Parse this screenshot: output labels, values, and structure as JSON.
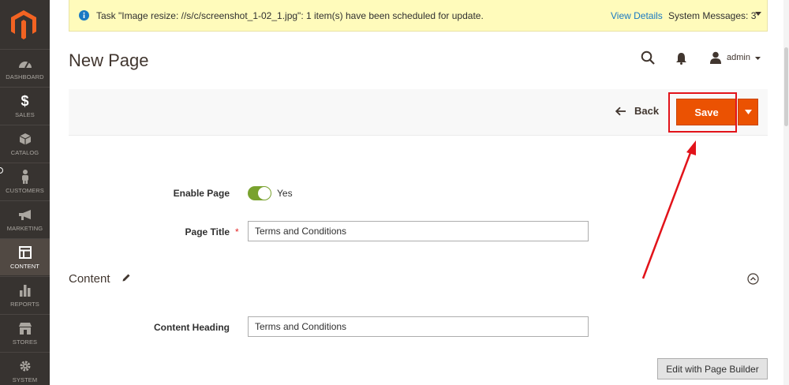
{
  "sidebar": {
    "items": [
      {
        "label": "DASHBOARD",
        "icon": "dashboard-icon"
      },
      {
        "label": "SALES",
        "icon": "dollar-icon"
      },
      {
        "label": "CATALOG",
        "icon": "cube-icon"
      },
      {
        "label": "CUSTOMERS",
        "icon": "person-icon"
      },
      {
        "label": "MARKETING",
        "icon": "megaphone-icon"
      },
      {
        "label": "CONTENT",
        "icon": "layout-icon",
        "active": true
      },
      {
        "label": "REPORTS",
        "icon": "bar-chart-icon"
      },
      {
        "label": "STORES",
        "icon": "store-icon"
      },
      {
        "label": "SYSTEM",
        "icon": "gear-icon"
      }
    ]
  },
  "system_message": {
    "text": "Task \"Image resize: //s/c/screenshot_1-02_1.jpg\": 1 item(s) have been scheduled for update.",
    "view_details": "View Details",
    "system_messages": "System Messages: 3"
  },
  "header": {
    "title": "New Page",
    "user": "admin"
  },
  "toolbar": {
    "back_label": "Back",
    "save_label": "Save"
  },
  "form": {
    "enable_page_label": "Enable Page",
    "enable_page_value": "Yes",
    "page_title_label": "Page Title",
    "page_title_value": "Terms and Conditions",
    "content_section_title": "Content",
    "content_heading_label": "Content Heading",
    "content_heading_value": "Terms and Conditions",
    "page_builder_button": "Edit with Page Builder"
  },
  "colors": {
    "accent": "#eb5202",
    "sidebar": "#373330",
    "toggle_on": "#79a22e",
    "annotation": "#e2131a"
  }
}
